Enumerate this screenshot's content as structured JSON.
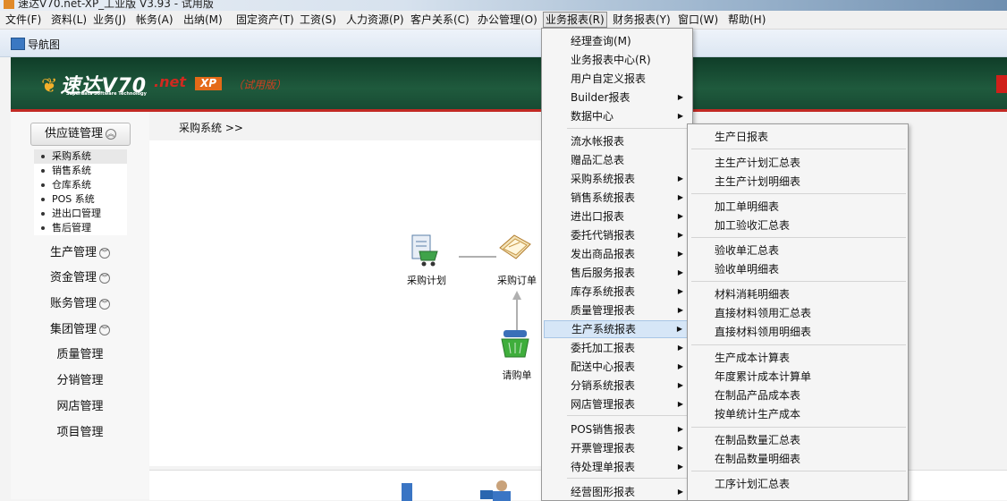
{
  "window": {
    "title": "速达V70.net-XP_工业版 V3.93 - 试用版"
  },
  "menubar": [
    {
      "label": "文件(F)"
    },
    {
      "label": "资料(L)"
    },
    {
      "label": "业务(J)"
    },
    {
      "label": "帐务(A)"
    },
    {
      "label": "出纳(M)"
    },
    {
      "label": "固定资产(T)"
    },
    {
      "label": "工资(S)"
    },
    {
      "label": "人力资源(P)"
    },
    {
      "label": "客户关系(C)"
    },
    {
      "label": "办公管理(O)"
    },
    {
      "label": "业务报表(R)"
    },
    {
      "label": "财务报表(Y)"
    },
    {
      "label": "窗口(W)"
    },
    {
      "label": "帮助(H)"
    }
  ],
  "nav": {
    "title": "导航图"
  },
  "banner": {
    "brand": "速达V70",
    "net": ".net",
    "xp": "XP",
    "trial": "（试用版）",
    "subtitle": "Superdata Software Technology"
  },
  "sidebar": {
    "active_group": "供应链管理",
    "sub_items": [
      "采购系统",
      "销售系统",
      "仓库系统",
      "POS 系统",
      "进出口管理",
      "售后管理"
    ],
    "modules_collapsible": [
      "生产管理",
      "资金管理",
      "账务管理",
      "集团管理"
    ],
    "modules_plain": [
      "质量管理",
      "分销管理",
      "网店管理",
      "项目管理"
    ]
  },
  "main": {
    "breadcrumb": "采购系统 >>",
    "flow": {
      "plan": "采购计划",
      "order": "采购订单",
      "request": "请购单"
    }
  },
  "report_menu": {
    "items": [
      {
        "label": "经理查询(M)",
        "sub": false
      },
      {
        "label": "业务报表中心(R)",
        "sub": false
      },
      {
        "label": "用户自定义报表",
        "sub": false
      },
      {
        "label": "Builder报表",
        "sub": true
      },
      {
        "label": "数据中心",
        "sub": true
      },
      {
        "label": "流水帐报表",
        "sub": false
      },
      {
        "label": "赠品汇总表",
        "sub": false
      },
      {
        "label": "采购系统报表",
        "sub": true
      },
      {
        "label": "销售系统报表",
        "sub": true
      },
      {
        "label": "进出口报表",
        "sub": true
      },
      {
        "label": "委托代销报表",
        "sub": true
      },
      {
        "label": "发出商品报表",
        "sub": true
      },
      {
        "label": "售后服务报表",
        "sub": true
      },
      {
        "label": "库存系统报表",
        "sub": true
      },
      {
        "label": "质量管理报表",
        "sub": true
      },
      {
        "label": "生产系统报表",
        "sub": true
      },
      {
        "label": "委托加工报表",
        "sub": true
      },
      {
        "label": "配送中心报表",
        "sub": true
      },
      {
        "label": "分销系统报表",
        "sub": true
      },
      {
        "label": "网店管理报表",
        "sub": true
      },
      {
        "label": "POS销售报表",
        "sub": true
      },
      {
        "label": "开票管理报表",
        "sub": true
      },
      {
        "label": "待处理单报表",
        "sub": true
      },
      {
        "label": "经营图形报表",
        "sub": true
      }
    ],
    "highlighted": "生产系统报表"
  },
  "production_submenu": {
    "items": [
      "生产日报表",
      "主生产计划汇总表",
      "主生产计划明细表",
      "加工单明细表",
      "加工验收汇总表",
      "验收单汇总表",
      "验收单明细表",
      "材料消耗明细表",
      "直接材料领用汇总表",
      "直接材料领用明细表",
      "生产成本计算表",
      "年度累计成本计算单",
      "在制品产品成本表",
      "按单统计生产成本",
      "在制品数量汇总表",
      "在制品数量明细表",
      "工序计划汇总表"
    ]
  },
  "colors": {
    "banner_green": "#1f5a3d",
    "accent_red": "#c22a24",
    "menu_highlight": "#d6e6f7"
  }
}
